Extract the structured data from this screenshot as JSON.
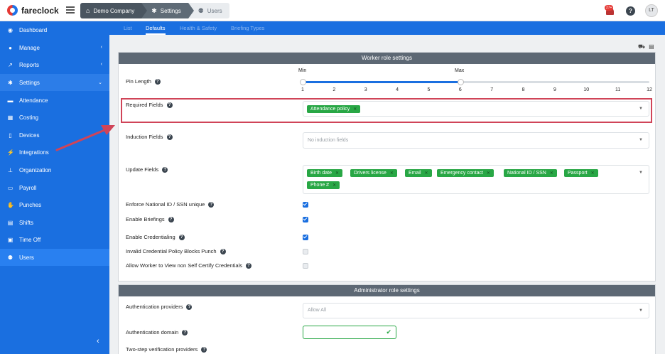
{
  "app": {
    "name": "fareclock"
  },
  "breadcrumbs": [
    "Demo Company",
    "Settings",
    "Users"
  ],
  "header": {
    "notifications": "27+",
    "help": "?",
    "avatar": "LT"
  },
  "sidebar": {
    "items": [
      {
        "label": "Dashboard",
        "icon": "dashboard-icon",
        "glyph": "◉"
      },
      {
        "label": "Manage",
        "icon": "user-icon",
        "glyph": "●",
        "chevron": "‹"
      },
      {
        "label": "Reports",
        "icon": "chart-icon",
        "glyph": "↗",
        "chevron": "‹"
      },
      {
        "label": "Settings",
        "icon": "gear-icon",
        "glyph": "✱",
        "chevron": "⌄"
      },
      {
        "label": "Attendance",
        "icon": "bed-icon",
        "glyph": "▬"
      },
      {
        "label": "Costing",
        "icon": "calculator-icon",
        "glyph": "▦"
      },
      {
        "label": "Devices",
        "icon": "tablet-icon",
        "glyph": "▯"
      },
      {
        "label": "Integrations",
        "icon": "plug-icon",
        "glyph": "⚡"
      },
      {
        "label": "Organization",
        "icon": "sitemap-icon",
        "glyph": "⊥"
      },
      {
        "label": "Payroll",
        "icon": "money-icon",
        "glyph": "▭"
      },
      {
        "label": "Punches",
        "icon": "hand-icon",
        "glyph": "✋"
      },
      {
        "label": "Shifts",
        "icon": "calendar-icon",
        "glyph": "▤"
      },
      {
        "label": "Time Off",
        "icon": "suitcase-icon",
        "glyph": "▣"
      },
      {
        "label": "Users",
        "icon": "users-icon",
        "glyph": "⚉"
      }
    ],
    "collapse": "‹"
  },
  "tabs": [
    "List",
    "Defaults",
    "Health & Safety",
    "Briefing Types"
  ],
  "worker_panel": {
    "title": "Worker role settings",
    "pin_length": {
      "label": "Pin Length",
      "min_label": "Min",
      "max_label": "Max",
      "min_value": 1,
      "max_value": 6,
      "ticks": [
        "1",
        "2",
        "3",
        "4",
        "5",
        "6",
        "7",
        "8",
        "9",
        "10",
        "11",
        "12"
      ]
    },
    "required_fields": {
      "label": "Required Fields",
      "chips": [
        "Attendance policy"
      ]
    },
    "induction_fields": {
      "label": "Induction Fields",
      "placeholder": "No induction fields"
    },
    "update_fields": {
      "label": "Update Fields",
      "chips": [
        "Birth date",
        "Drivers license",
        "Email",
        "Emergency contact",
        "National ID / SSN",
        "Passport",
        "Phone #"
      ]
    },
    "checkboxes": [
      {
        "label": "Enforce National ID / SSN unique",
        "checked": true
      },
      {
        "label": "Enable Briefings",
        "checked": true
      },
      {
        "label": "Enable Credentialing",
        "checked": true
      },
      {
        "label": "Invalid Credential Policy Blocks Punch",
        "checked": false
      },
      {
        "label": "Allow Worker to View non Self Certify Credentials",
        "checked": false
      }
    ]
  },
  "admin_panel": {
    "title": "Administrator role settings",
    "auth_providers": {
      "label": "Authentication providers",
      "value": "Allow All"
    },
    "auth_domain": {
      "label": "Authentication domain",
      "value": ""
    },
    "two_step": {
      "label": "Two-step verification providers"
    }
  },
  "colors": {
    "sidebar": "#1a6fe0",
    "chip": "#28a745",
    "highlight": "#d04458",
    "panel_head": "#5d6874"
  }
}
